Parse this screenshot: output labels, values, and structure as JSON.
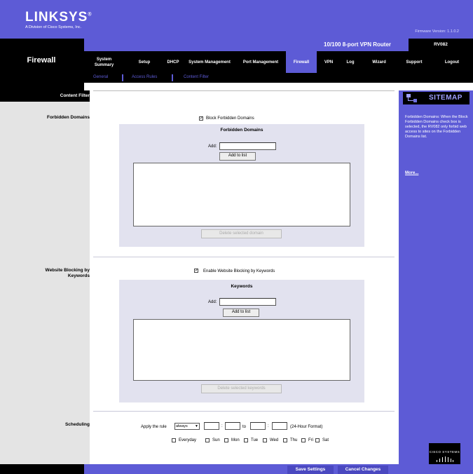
{
  "brand": {
    "logo": "LINKSYS",
    "logo_mark": "®",
    "tagline": "A Division of Cisco Systems, Inc."
  },
  "firmware": "Firmware Version: 1.1.0.2",
  "product": {
    "name": "10/100 8-port VPN Router",
    "model": "RV082"
  },
  "section_title": "Firewall",
  "nav_tabs": [
    "System Summary",
    "Setup",
    "DHCP",
    "System Management",
    "Port Management",
    "Firewall",
    "VPN",
    "Log",
    "Wizard",
    "Support",
    "Logout"
  ],
  "sub_tabs": [
    "General",
    "Access Rules",
    "Content Filter"
  ],
  "labels": {
    "content_filter": "Content Filter",
    "forbidden_domains": "Forbidden Domains",
    "website_blocking": "Website Blocking by Keywords",
    "scheduling": "Scheduling"
  },
  "forbidden": {
    "checkbox_label": "Block Forbidden Domains",
    "checked": true,
    "panel_title": "Forbidden Domains",
    "add_label": "Add:",
    "add_value": "",
    "add_button": "Add to list",
    "delete_button": "Delete selected domain"
  },
  "keywords": {
    "checkbox_label": "Enable Website Blocking by Keywords",
    "checked": true,
    "panel_title": "Keywords",
    "add_label": "Add:",
    "add_value": "",
    "add_button": "Add to list",
    "delete_button": "Delete selected keywords"
  },
  "scheduling": {
    "apply_label": "Apply the rule",
    "rule_value": "always",
    "colon": ":",
    "to_label": "to",
    "format_label": "(24-Hour Format)",
    "days": [
      "Everyday",
      "Sun",
      "Mon",
      "Tue",
      "Wed",
      "Thu",
      "Fri",
      "Sat"
    ]
  },
  "sitemap": {
    "title": "SITEMAP",
    "help_text": "Forbidden Domains: When the Block Forbidden Domains check box is selected, the RV082 only forbid web access to sites on the Forbidden Domains list.",
    "more": "More..."
  },
  "footer": {
    "save": "Save Settings",
    "cancel": "Cancel Changes"
  },
  "cisco": "CISCO SYSTEMS",
  "colors": {
    "brand_blue": "#5d5bd6",
    "panel": "#e2e2ef",
    "left_column": "#e4e4e4"
  }
}
